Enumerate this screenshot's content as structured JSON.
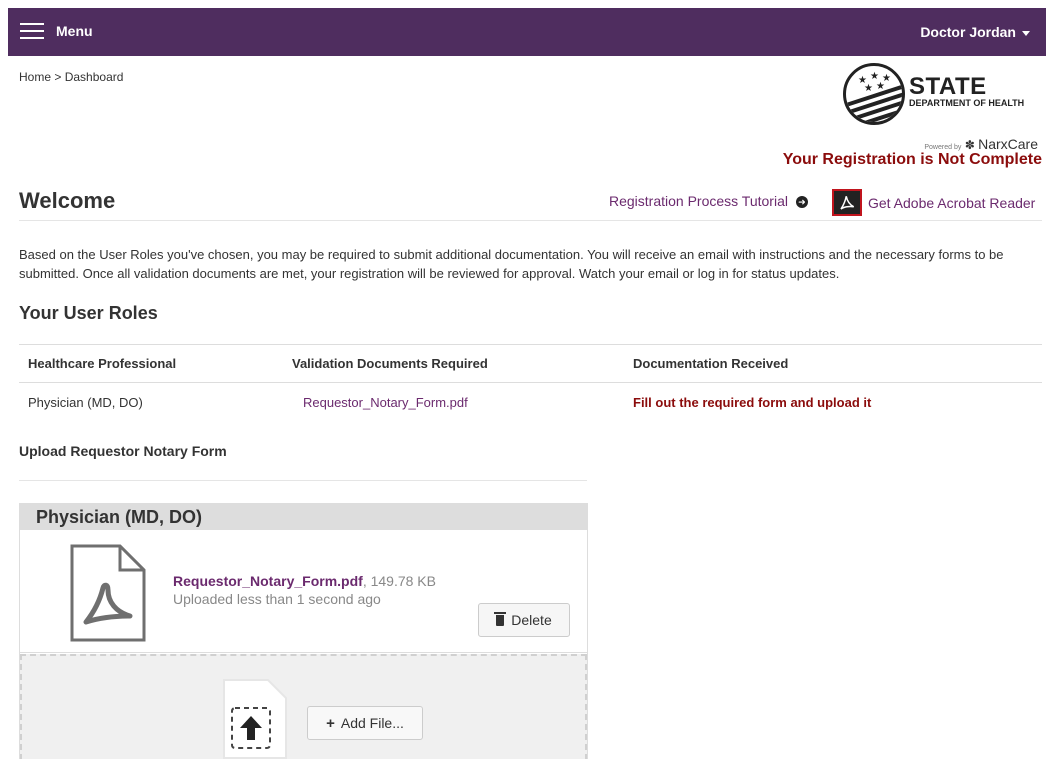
{
  "header": {
    "menu_label": "Menu",
    "user_name": "Doctor Jordan"
  },
  "breadcrumb": {
    "home": "Home",
    "separator": " > ",
    "current": "Dashboard"
  },
  "logo": {
    "line1": "STATE",
    "line2": "DEPARTMENT OF HEALTH",
    "powered_by": "Powered by",
    "brand": "NarxCare"
  },
  "registration_warning": "Your Registration is Not Complete",
  "welcome_title": "Welcome",
  "links": {
    "tutorial": "Registration Process Tutorial",
    "acrobat": "Get Adobe Acrobat Reader"
  },
  "intro_text": "Based on the User Roles you've chosen, you may be required to submit additional documentation. You will receive an email with instructions and the necessary forms to be submitted. Once all validation documents are met, your registration will be reviewed for approval. Watch your email or log in for status updates.",
  "roles": {
    "title": "Your User Roles",
    "headers": [
      "Healthcare Professional",
      "Validation Documents Required",
      "Documentation Received"
    ],
    "rows": [
      {
        "role": "Physician (MD, DO)",
        "document": "Requestor_Notary_Form.pdf",
        "status": "Fill out the required form and upload it"
      }
    ]
  },
  "upload": {
    "title": "Upload Requestor Notary Form",
    "panel_title": "Physician (MD, DO)",
    "file_name": "Requestor_Notary_Form.pdf",
    "file_size": ", 149.78 KB",
    "uploaded": "Uploaded less than 1 second ago",
    "delete_label": "Delete",
    "add_label": "Add File..."
  },
  "colors": {
    "header_bg": "#4f2d5f",
    "link": "#6b2a6e",
    "warning": "#8b0c0c"
  }
}
